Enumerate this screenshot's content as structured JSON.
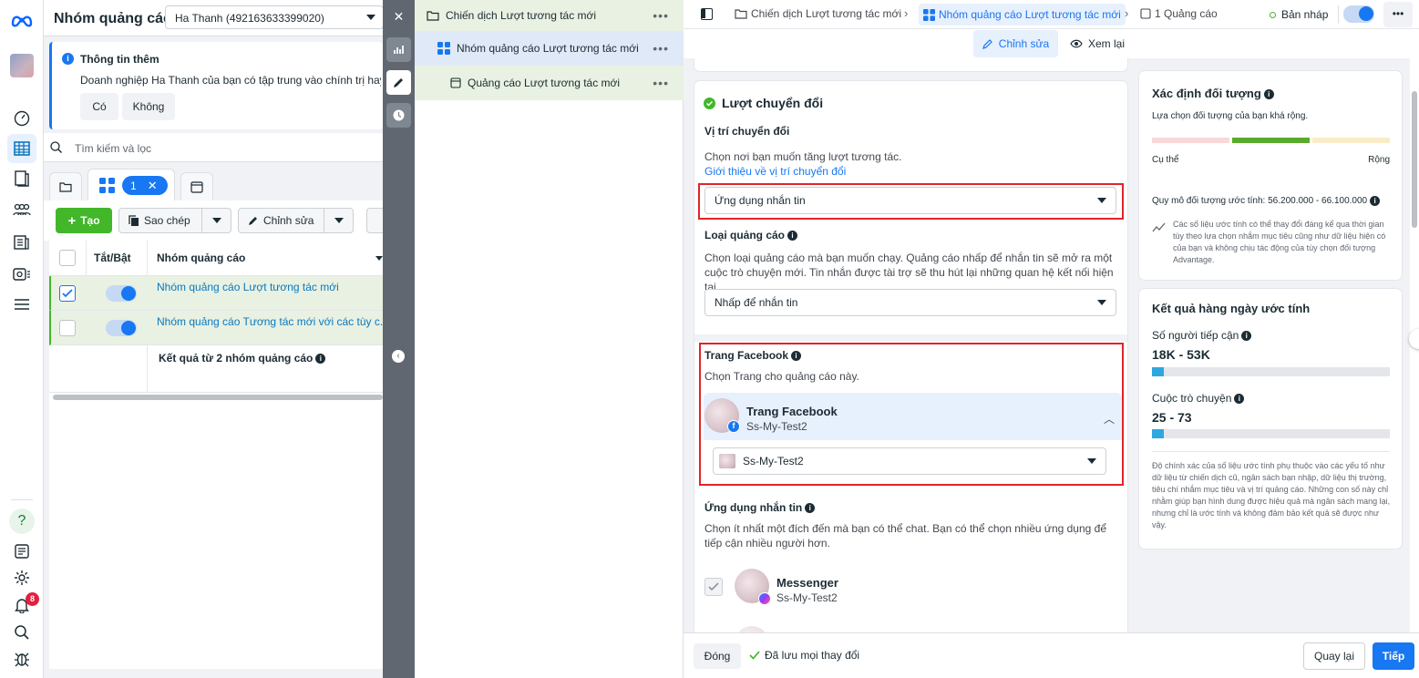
{
  "rail": {
    "items": [
      "meta-logo",
      "account",
      "dashboard",
      "campaigns",
      "pages",
      "audiences",
      "catalog",
      "events",
      "menu",
      "help",
      "inbox",
      "settings",
      "notifications",
      "search",
      "bug"
    ],
    "notification_count": "8"
  },
  "manager": {
    "title": "Nhóm quảng cáo",
    "account": "Ha Thanh (492163633399020)",
    "info": {
      "title": "Thông tin thêm",
      "text": "Doanh nghiệp Ha Thanh của bạn có tập trung vào chính trị hay ủng",
      "yes": "Có",
      "no": "Không"
    },
    "search_placeholder": "Tìm kiếm và lọc",
    "selected_count": "1",
    "toolbar": {
      "create": "Tạo",
      "copy": "Sao chép",
      "edit": "Chỉnh sửa"
    },
    "table": {
      "col_toggle": "Tắt/Bật",
      "col_name": "Nhóm quảng cáo",
      "rows": [
        {
          "name": "Nhóm quảng cáo Lượt tương tác mới",
          "checked": true
        },
        {
          "name": "Nhóm quảng cáo Tương tác mới với các tùy c...",
          "checked": false
        }
      ],
      "summary": "Kết quả từ 2 nhóm quảng cáo"
    }
  },
  "tree": {
    "campaign": "Chiến dịch Lượt tương tác mới",
    "adset": "Nhóm quảng cáo Lượt tương tác mới",
    "ad": "Quảng cáo Lượt tương tác mới"
  },
  "topbar": {
    "crumb_campaign": "Chiến dịch Lượt tương tác mới",
    "crumb_adset": "Nhóm quảng cáo Lượt tương tác mới",
    "crumb_ads": "1 Quảng cáo",
    "status": "Bản nháp",
    "edit_tab": "Chỉnh sửa",
    "review_tab": "Xem lại"
  },
  "conversion": {
    "title": "Lượt chuyển đổi",
    "location_label": "Vị trí chuyển đổi",
    "location_desc": "Chọn nơi bạn muốn tăng lượt tương tác.",
    "location_link": "Giới thiệu về vị trí chuyển đổi",
    "location_value": "Ứng dụng nhắn tin",
    "adtype_label": "Loại quảng cáo",
    "adtype_desc": "Chọn loại quảng cáo mà bạn muốn chạy. Quảng cáo nhấp để nhắn tin sẽ mở ra một cuộc trò chuyện mới. Tin nhắn được tài trợ sẽ thu hút lại những quan hệ kết nối hiện tại.",
    "adtype_value": "Nhấp để nhắn tin",
    "fbpage_label": "Trang Facebook",
    "fbpage_desc": "Chọn Trang cho quảng cáo này.",
    "fbpage_card_title": "Trang Facebook",
    "fbpage_card_sub": "Ss-My-Test2",
    "fbpage_value": "Ss-My-Test2",
    "apps_label": "Ứng dụng nhắn tin",
    "apps_desc": "Chọn ít nhất một đích đến mà bạn có thể chat. Bạn có thể chọn nhiều ứng dụng để tiếp cận nhiều người hơn.",
    "messenger_title": "Messenger",
    "messenger_sub": "Ss-My-Test2"
  },
  "audience": {
    "title": "Xác định đối tượng",
    "desc": "Lựa chọn đối tượng của bạn khá rộng.",
    "left": "Cụ thể",
    "right": "Rộng",
    "size": "Quy mô đối tượng ước tính: 56.200.000 - 66.100.000",
    "note": "Các số liệu ước tính có thể thay đổi đáng kể qua thời gian tùy theo lựa chọn nhắm mục tiêu cũng như dữ liệu hiện có của bạn và không chịu tác động của tùy chọn đối tượng Advantage."
  },
  "results": {
    "title": "Kết quả hàng ngày ước tính",
    "reach_label": "Số người tiếp cận",
    "reach_value": "18K - 53K",
    "reach_fill": 0.05,
    "conv_label": "Cuộc trò chuyện",
    "conv_value": "25 - 73",
    "conv_fill": 0.05,
    "note": "Độ chính xác của số liệu ước tính phụ thuộc vào các yếu tố như dữ liệu từ chiến dịch cũ, ngân sách bạn nhập, dữ liệu thị trường, tiêu chí nhắm mục tiêu và vị trí quảng cáo. Những con số này chỉ nhằm giúp bạn hình dung được hiệu quả mà ngân sách mang lại, nhưng chỉ là ước tính và không đảm bảo kết quả sẽ được như vậy."
  },
  "footer": {
    "close": "Đóng",
    "saved": "Đã lưu mọi thay đổi",
    "back": "Quay lại",
    "next": "Tiếp"
  },
  "colors": {
    "accent": "#1877f2",
    "highlight": "#e0242a",
    "success": "#42b72a"
  }
}
